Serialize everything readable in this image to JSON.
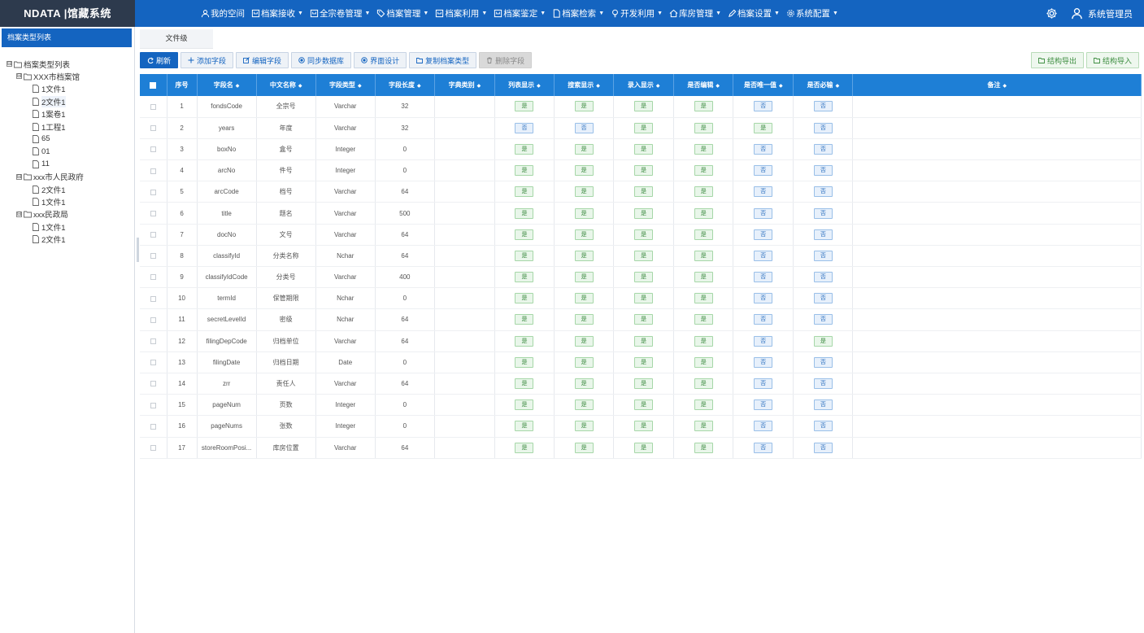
{
  "brand": "NDATA |馆藏系统",
  "nav": [
    {
      "label": "我的空间",
      "icon": "person-icon",
      "caret": false
    },
    {
      "label": "档案接收",
      "icon": "archive-icon",
      "caret": true
    },
    {
      "label": "全宗卷管理",
      "icon": "archive-icon",
      "caret": true
    },
    {
      "label": "档案管理",
      "icon": "tag-icon",
      "caret": true
    },
    {
      "label": "档案利用",
      "icon": "archive-icon",
      "caret": true
    },
    {
      "label": "档案鉴定",
      "icon": "archive-icon",
      "caret": true
    },
    {
      "label": "档案检索",
      "icon": "document-icon",
      "caret": true
    },
    {
      "label": "开发利用",
      "icon": "bulb-icon",
      "caret": true
    },
    {
      "label": "库房管理",
      "icon": "home-icon",
      "caret": true
    },
    {
      "label": "档案设置",
      "icon": "pencil-icon",
      "caret": true
    },
    {
      "label": "系统配置",
      "icon": "gear-icon",
      "caret": true
    }
  ],
  "user": {
    "name": "系统管理员"
  },
  "sidebar": {
    "title": "档案类型列表",
    "tree": [
      {
        "label": "档案类型列表",
        "level": 0,
        "type": "folder",
        "toggle": "⊟",
        "selected": false
      },
      {
        "label": "XXX市档案馆",
        "level": 1,
        "type": "folder",
        "toggle": "⊟",
        "selected": false
      },
      {
        "label": "1文件1",
        "level": 2,
        "type": "file",
        "toggle": "",
        "selected": false
      },
      {
        "label": "2文件1",
        "level": 2,
        "type": "file",
        "toggle": "",
        "selected": true
      },
      {
        "label": "1案卷1",
        "level": 2,
        "type": "file",
        "toggle": "",
        "selected": false
      },
      {
        "label": "1工程1",
        "level": 2,
        "type": "file",
        "toggle": "",
        "selected": false
      },
      {
        "label": "65",
        "level": 2,
        "type": "file",
        "toggle": "",
        "selected": false
      },
      {
        "label": "01",
        "level": 2,
        "type": "file",
        "toggle": "",
        "selected": false
      },
      {
        "label": "11",
        "level": 2,
        "type": "file",
        "toggle": "",
        "selected": false
      },
      {
        "label": "xxx市人民政府",
        "level": 1,
        "type": "folder",
        "toggle": "⊟",
        "selected": false
      },
      {
        "label": "2文件1",
        "level": 2,
        "type": "file",
        "toggle": "",
        "selected": false
      },
      {
        "label": "1文件1",
        "level": 2,
        "type": "file",
        "toggle": "",
        "selected": false
      },
      {
        "label": "xxx民政局",
        "level": 1,
        "type": "folder",
        "toggle": "⊟",
        "selected": false
      },
      {
        "label": "1文件1",
        "level": 2,
        "type": "file",
        "toggle": "",
        "selected": false
      },
      {
        "label": "2文件1",
        "level": 2,
        "type": "file",
        "toggle": "",
        "selected": false
      }
    ]
  },
  "tab": {
    "label": "文件级"
  },
  "toolbar": {
    "buttons": [
      {
        "label": "刷新",
        "name": "refresh-button",
        "icon": "refresh-icon",
        "style": "primary"
      },
      {
        "label": "添加字段",
        "name": "add-field-button",
        "icon": "plus-icon",
        "style": ""
      },
      {
        "label": "编辑字段",
        "name": "edit-field-button",
        "icon": "edit-icon",
        "style": ""
      },
      {
        "label": "同步数据库",
        "name": "sync-database-button",
        "icon": "radio-icon",
        "style": ""
      },
      {
        "label": "界面设计",
        "name": "ui-design-button",
        "icon": "radio-icon",
        "style": ""
      },
      {
        "label": "复制档案类型",
        "name": "copy-archive-type-button",
        "icon": "folder-icon",
        "style": ""
      },
      {
        "label": "删除字段",
        "name": "delete-field-button",
        "icon": "trash-icon",
        "style": "disabled"
      }
    ],
    "right_buttons": [
      {
        "label": "结构导出",
        "name": "structure-export-button",
        "icon": "folder-icon",
        "style": "green"
      },
      {
        "label": "结构导入",
        "name": "structure-import-button",
        "icon": "folder-icon",
        "style": "green"
      }
    ]
  },
  "table": {
    "columns": [
      "序号",
      "字段名",
      "中文名称",
      "字段类型",
      "字段长度",
      "字典类别",
      "列表显示",
      "搜索显示",
      "录入显示",
      "是否编辑",
      "是否唯一值",
      "是否必输",
      "备注"
    ],
    "yes_label": "是",
    "no_label": "否",
    "rows": [
      {
        "no": "1",
        "field": "fondsCode",
        "cn": "全宗号",
        "type": "Varchar",
        "len": "32",
        "dict": "",
        "flags": [
          true,
          true,
          true,
          true,
          false,
          false
        ]
      },
      {
        "no": "2",
        "field": "years",
        "cn": "年度",
        "type": "Varchar",
        "len": "32",
        "dict": "",
        "flags": [
          false,
          false,
          true,
          true,
          true,
          false
        ]
      },
      {
        "no": "3",
        "field": "boxNo",
        "cn": "盒号",
        "type": "Integer",
        "len": "0",
        "dict": "",
        "flags": [
          true,
          true,
          true,
          true,
          false,
          false
        ]
      },
      {
        "no": "4",
        "field": "arcNo",
        "cn": "件号",
        "type": "Integer",
        "len": "0",
        "dict": "",
        "flags": [
          true,
          true,
          true,
          true,
          false,
          false
        ]
      },
      {
        "no": "5",
        "field": "arcCode",
        "cn": "档号",
        "type": "Varchar",
        "len": "64",
        "dict": "",
        "flags": [
          true,
          true,
          true,
          true,
          false,
          false
        ]
      },
      {
        "no": "6",
        "field": "title",
        "cn": "题名",
        "type": "Varchar",
        "len": "500",
        "dict": "",
        "flags": [
          true,
          true,
          true,
          true,
          false,
          false
        ]
      },
      {
        "no": "7",
        "field": "docNo",
        "cn": "文号",
        "type": "Varchar",
        "len": "64",
        "dict": "",
        "flags": [
          true,
          true,
          true,
          true,
          false,
          false
        ]
      },
      {
        "no": "8",
        "field": "classifyId",
        "cn": "分类名称",
        "type": "Nchar",
        "len": "64",
        "dict": "",
        "flags": [
          true,
          true,
          true,
          true,
          false,
          false
        ]
      },
      {
        "no": "9",
        "field": "classifyIdCode",
        "cn": "分类号",
        "type": "Varchar",
        "len": "400",
        "dict": "",
        "flags": [
          true,
          true,
          true,
          true,
          false,
          false
        ]
      },
      {
        "no": "10",
        "field": "termId",
        "cn": "保管期限",
        "type": "Nchar",
        "len": "0",
        "dict": "",
        "flags": [
          true,
          true,
          true,
          true,
          false,
          false
        ]
      },
      {
        "no": "11",
        "field": "secretLevelId",
        "cn": "密级",
        "type": "Nchar",
        "len": "64",
        "dict": "",
        "flags": [
          true,
          true,
          true,
          true,
          false,
          false
        ]
      },
      {
        "no": "12",
        "field": "filingDepCode",
        "cn": "归档单位",
        "type": "Varchar",
        "len": "64",
        "dict": "",
        "flags": [
          true,
          true,
          true,
          true,
          false,
          true
        ]
      },
      {
        "no": "13",
        "field": "filingDate",
        "cn": "归档日期",
        "type": "Date",
        "len": "0",
        "dict": "",
        "flags": [
          true,
          true,
          true,
          true,
          false,
          false
        ]
      },
      {
        "no": "14",
        "field": "zrr",
        "cn": "责任人",
        "type": "Varchar",
        "len": "64",
        "dict": "",
        "flags": [
          true,
          true,
          true,
          true,
          false,
          false
        ]
      },
      {
        "no": "15",
        "field": "pageNum",
        "cn": "页数",
        "type": "Integer",
        "len": "0",
        "dict": "",
        "flags": [
          true,
          true,
          true,
          true,
          false,
          false
        ]
      },
      {
        "no": "16",
        "field": "pageNums",
        "cn": "张数",
        "type": "Integer",
        "len": "0",
        "dict": "",
        "flags": [
          true,
          true,
          true,
          true,
          false,
          false
        ]
      },
      {
        "no": "17",
        "field": "storeRoomPosi...",
        "cn": "库房位置",
        "type": "Varchar",
        "len": "64",
        "dict": "",
        "flags": [
          true,
          true,
          true,
          true,
          false,
          false
        ]
      }
    ]
  },
  "colors": {
    "nav": "#1464c0",
    "brand_bg": "#2d3a4d",
    "header": "#1e7fd6",
    "yes": "#3c8b40",
    "no": "#2b6fbf"
  }
}
